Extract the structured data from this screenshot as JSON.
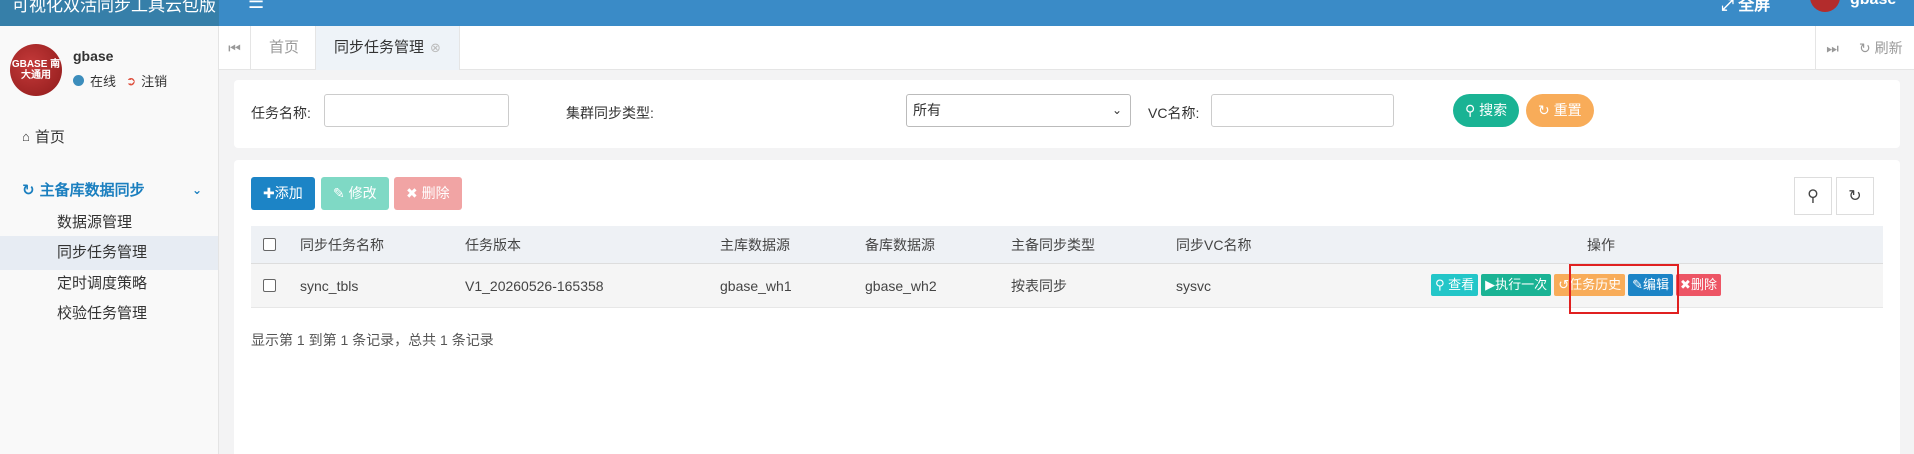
{
  "header": {
    "brand": "可视化双活同步工具云包版",
    "menu_icon": "hamburger-icon",
    "fullscreen_label": "全屏",
    "user": "gbase"
  },
  "sidebar": {
    "avatar_text": "GBASE 南大通用",
    "user_name": "gbase",
    "status_online": "在线",
    "logout": "注销",
    "home": "首页",
    "group_label": "主备库数据同步",
    "sub_items": [
      "数据源管理",
      "同步任务管理",
      "定时调度策略",
      "校验任务管理"
    ],
    "active_index": 1
  },
  "tabs": {
    "items": [
      "首页",
      "同步任务管理"
    ],
    "active": "同步任务管理",
    "refresh": "刷新"
  },
  "search": {
    "task_name_label": "任务名称:",
    "cluster_type_label": "集群同步类型:",
    "cluster_type_value": "所有",
    "vc_name_label": "VC名称:",
    "search_btn": "搜索",
    "reset_btn": "重置"
  },
  "toolbar": {
    "add": "添加",
    "edit": "修改",
    "delete": "删除"
  },
  "table": {
    "columns": [
      "同步任务名称",
      "任务版本",
      "主库数据源",
      "备库数据源",
      "主备同步类型",
      "同步VC名称",
      "操作"
    ],
    "rows": [
      {
        "name": "sync_tbls",
        "version": "V1_20260526-165358",
        "primary": "gbase_wh1",
        "standby": "gbase_wh2",
        "sync_type": "按表同步",
        "vc": "sysvc"
      }
    ],
    "actions": [
      "查看",
      "执行一次",
      "任务历史",
      "编辑",
      "删除"
    ]
  },
  "pager": "显示第 1 到第 1 条记录，总共 1 条记录",
  "colors": {
    "header": "#3a8bc7",
    "green": "#1ab394",
    "orange": "#f8ac59",
    "blue": "#1c84c6",
    "red": "#ed5565",
    "highlight": "#e02020"
  }
}
